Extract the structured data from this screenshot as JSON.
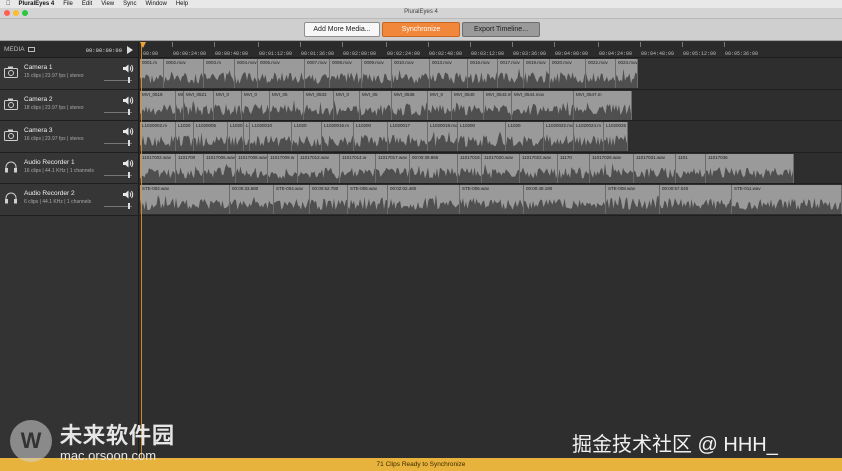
{
  "menubar": {
    "app": "PluralEyes 4",
    "items": [
      "File",
      "Edit",
      "View",
      "Sync",
      "Window",
      "Help"
    ]
  },
  "window": {
    "title": "PluralEyes 4"
  },
  "toolbar": {
    "add_label": "Add More Media...",
    "sync_label": "Synchronize",
    "export_label": "Export Timeline..."
  },
  "media": {
    "label": "MEDIA",
    "timecode": "00:00:00:00"
  },
  "ruler": {
    "labels": [
      "00:00",
      "00:00:24:00",
      "00:00:48:00",
      "00:01:12:00",
      "00:01:36:00",
      "00:02:00:00",
      "00:02:24:00",
      "00:02:48:00",
      "00:03:12:00",
      "00:03:36:00",
      "00:04:00:00",
      "00:04:24:00",
      "00:04:48:00",
      "00:05:12:00",
      "00:05:36:00"
    ]
  },
  "tracks": [
    {
      "name": "Camera 1",
      "clips_count": "15 clips",
      "rate": "23.97 fps",
      "channels": "stereo",
      "icon": "camera-icon"
    },
    {
      "name": "Camera 2",
      "clips_count": "18 clips",
      "rate": "23.97 fps",
      "channels": "stereo",
      "icon": "camera-icon"
    },
    {
      "name": "Camera 3",
      "clips_count": "16 clips",
      "rate": "23.97 fps",
      "channels": "stereo",
      "icon": "camera-icon"
    },
    {
      "name": "Audio Recorder 1",
      "clips_count": "16 clips",
      "rate": "44.1 KHz",
      "channels": "1 channels",
      "icon": "headphones-icon"
    },
    {
      "name": "Audio Recorder 2",
      "clips_count": "6 clips",
      "rate": "44.1 KHz",
      "channels": "1 channels",
      "icon": "headphones-icon"
    }
  ],
  "lanes": [
    {
      "clips": [
        "0001.m",
        "0002.mov",
        "0003.m",
        "0004.mov",
        "0005.mov",
        "0007.mov",
        "0008.mov",
        "0009.mov",
        "0010.mov",
        "0013.mov",
        "0016.mov",
        "0017.mov",
        "0019.mov",
        "0020.mov",
        "0022.mov",
        "0023.mov"
      ]
    },
    {
      "clips": [
        "MVI_0518",
        "MI",
        "MVI_0521",
        "MVI_0",
        "MVI_0",
        "MVI_05",
        "MVI_0533",
        "MVI_0",
        "MVI_05",
        "MVI_0538",
        "MVI_0",
        "MVI_0540",
        "MVI_0543.mo",
        "MVI_0544.mov",
        "MVI_0547.m"
      ]
    },
    {
      "clips": [
        "L1020002.m",
        "L1020",
        "L1020005",
        "L1020",
        "L1",
        "L1020010",
        "L1020",
        "L1020016.m",
        "L10200",
        "L1020017",
        "L1020018.mov",
        "L10200",
        "L1020",
        "L1020022.mov",
        "L1020024.m",
        "L1020026"
      ]
    },
    {
      "clips": [
        "11017002.wav",
        "1101700",
        "11017006.wav",
        "11017008.wav",
        "11017009.w",
        "11017012.wav",
        "11017014.w",
        "11017017.wav",
        "00:00:39.865",
        "11017018.wav",
        "11017020.wav",
        "11017022.wav",
        "11170",
        "11017026.wav",
        "11017031.wav",
        "1101",
        "11017036"
      ]
    },
    {
      "clips": [
        "STE-002.wav",
        "00:00:33.680",
        "STE-004.wav",
        "00:00:52.780",
        "STE-005.wav",
        "00:02:02.480",
        "STE-006.wav",
        "00:00:48.190",
        "STE-008.wav",
        "00:00:57.040",
        "STE-011.wav"
      ]
    }
  ],
  "status": {
    "text": "71 Clips Ready to Synchronize"
  },
  "watermark": {
    "logo_char": "W",
    "cn_text": "未来软件园",
    "url": "mac.orsoon.com",
    "right_text": "掘金技术社区 @ HHH_"
  },
  "colors": {
    "sync_accent": "#f0873a",
    "status_bar": "#e8b33c",
    "clip": "#9a9a9a",
    "playhead": "#e38f2c"
  }
}
